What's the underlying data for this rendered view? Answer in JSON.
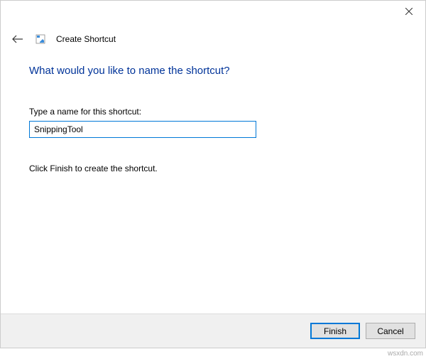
{
  "header": {
    "wizard_title": "Create Shortcut"
  },
  "content": {
    "heading": "What would you like to name the shortcut?",
    "field_label": "Type a name for this shortcut:",
    "input_value": "SnippingTool",
    "instruction": "Click Finish to create the shortcut."
  },
  "footer": {
    "finish_label": "Finish",
    "cancel_label": "Cancel"
  },
  "watermark": "wsxdn.com"
}
